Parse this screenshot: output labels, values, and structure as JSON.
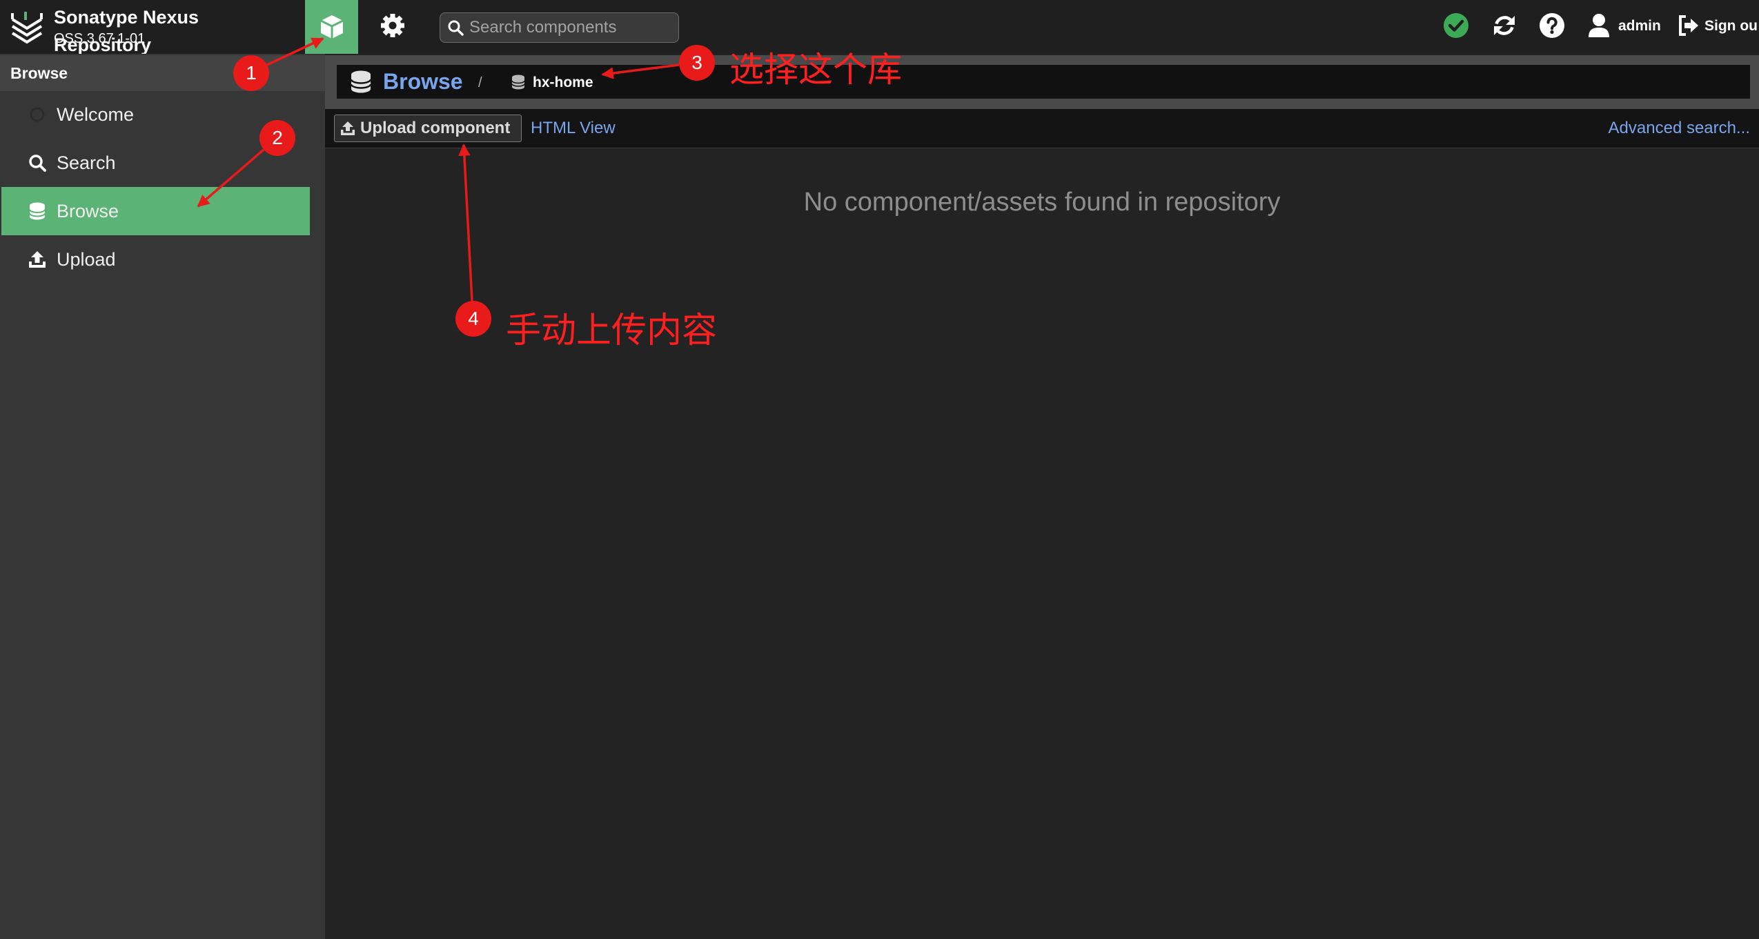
{
  "header": {
    "title_line1": "Sonatype Nexus",
    "title_line2": "Repository",
    "version": "OSS 3.67.1-01",
    "search_placeholder": "Search components",
    "username": "admin",
    "sign_out_label": "Sign ou",
    "icons": [
      "sonatype-logo-icon",
      "cube-icon",
      "gear-icon",
      "search-icon",
      "check-circle-icon",
      "refresh-icon",
      "help-icon",
      "user-icon",
      "sign-out-icon"
    ]
  },
  "sidebar": {
    "title": "Browse",
    "items": [
      {
        "label": "Welcome",
        "icon": "welcome-icon",
        "selected": false
      },
      {
        "label": "Search",
        "icon": "search-icon",
        "selected": false
      },
      {
        "label": "Browse",
        "icon": "database-icon",
        "selected": true
      },
      {
        "label": "Upload",
        "icon": "upload-icon",
        "selected": false
      }
    ]
  },
  "breadcrumb": {
    "root": "Browse",
    "separator": "/",
    "repository": "hx-home"
  },
  "toolbar": {
    "upload_label": "Upload component",
    "html_view_label": "HTML View",
    "advanced_search_label": "Advanced search..."
  },
  "content": {
    "empty_message": "No component/assets found in repository"
  },
  "annotations": [
    {
      "number": "1"
    },
    {
      "number": "2"
    },
    {
      "number": "3",
      "text": "选择这个库"
    },
    {
      "number": "4",
      "text": "手动上传内容"
    }
  ],
  "colors": {
    "accent_green": "#5cb376",
    "link_blue": "#77a6ee",
    "status_ok": "#3daa58",
    "annotation_red": "#e81a1a",
    "header_bg": "#1f1f1f",
    "sidebar_bg": "#363636",
    "content_bg": "#232323"
  }
}
